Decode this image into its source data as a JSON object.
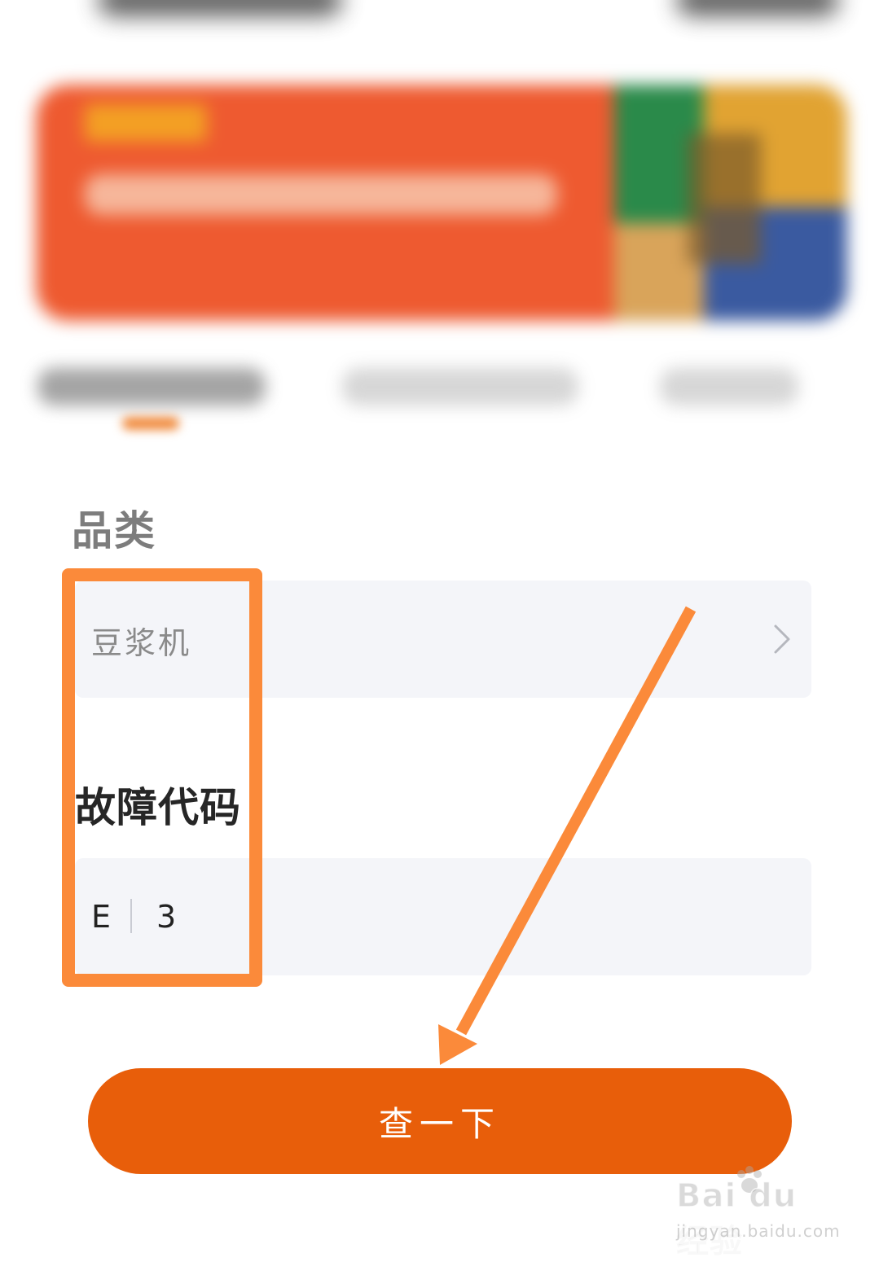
{
  "form": {
    "category_label": "品类",
    "category_value": "豆浆机",
    "code_label": "故障代码",
    "code_chars": [
      "E",
      "3"
    ]
  },
  "actions": {
    "query_label": "查一下"
  },
  "watermark": {
    "brand": "Bai du 经验",
    "url": "jingyan.baidu.com"
  },
  "colors": {
    "accent": "#e85e0a",
    "highlight": "#fb8a3a",
    "banner": "#ee5a30",
    "field_bg": "#f4f5f9"
  },
  "icons": {
    "category_chevron": "chevron-right-icon",
    "annotation": "arrow-annotation"
  }
}
